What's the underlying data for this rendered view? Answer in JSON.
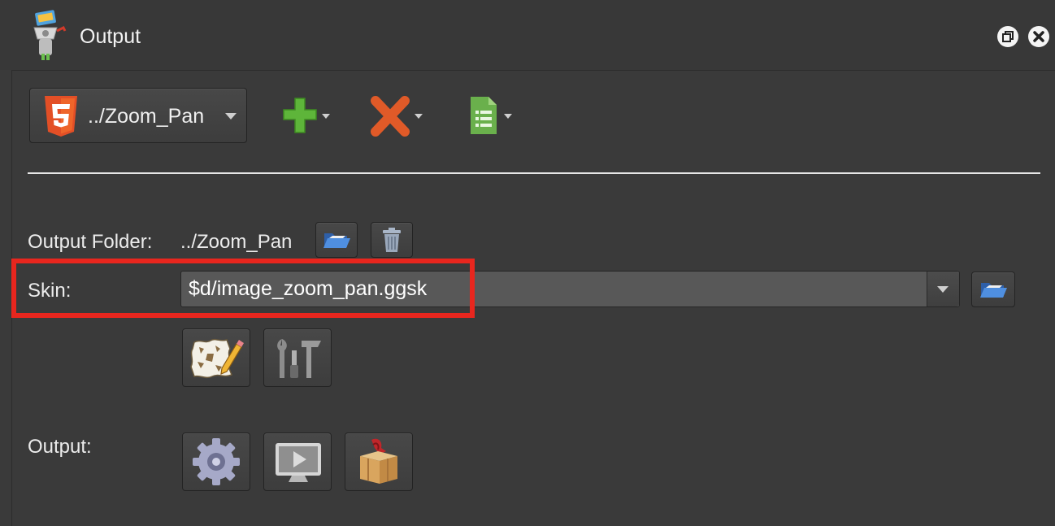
{
  "window": {
    "title": "Output",
    "icons": [
      "app-icon",
      "restore-icon",
      "close-icon"
    ]
  },
  "toolbar": {
    "format_select_value": "../Zoom_Pan",
    "format_icon": "html5-icon",
    "add_icon": "plus-icon",
    "remove_icon": "x-icon",
    "list_icon": "document-list-icon"
  },
  "output_folder": {
    "label": "Output Folder:",
    "value": "../Zoom_Pan",
    "browse_icon": "folder-open-icon",
    "clear_icon": "trash-icon"
  },
  "skin": {
    "label": "Skin:",
    "value": "$d/image_zoom_pan.ggsk",
    "browse_icon": "folder-open-icon",
    "edit_icon": "skin-editor-icon",
    "settings_icon": "tools-icon"
  },
  "output": {
    "label": "Output:",
    "icons": [
      "gear-icon",
      "preview-icon",
      "package-icon"
    ]
  },
  "colors": {
    "background": "#3a3a3a",
    "highlight": "#e8261e",
    "html5": "#e34f26",
    "add": "#5eb53a",
    "remove": "#e05a28",
    "list": "#6ab04c"
  }
}
